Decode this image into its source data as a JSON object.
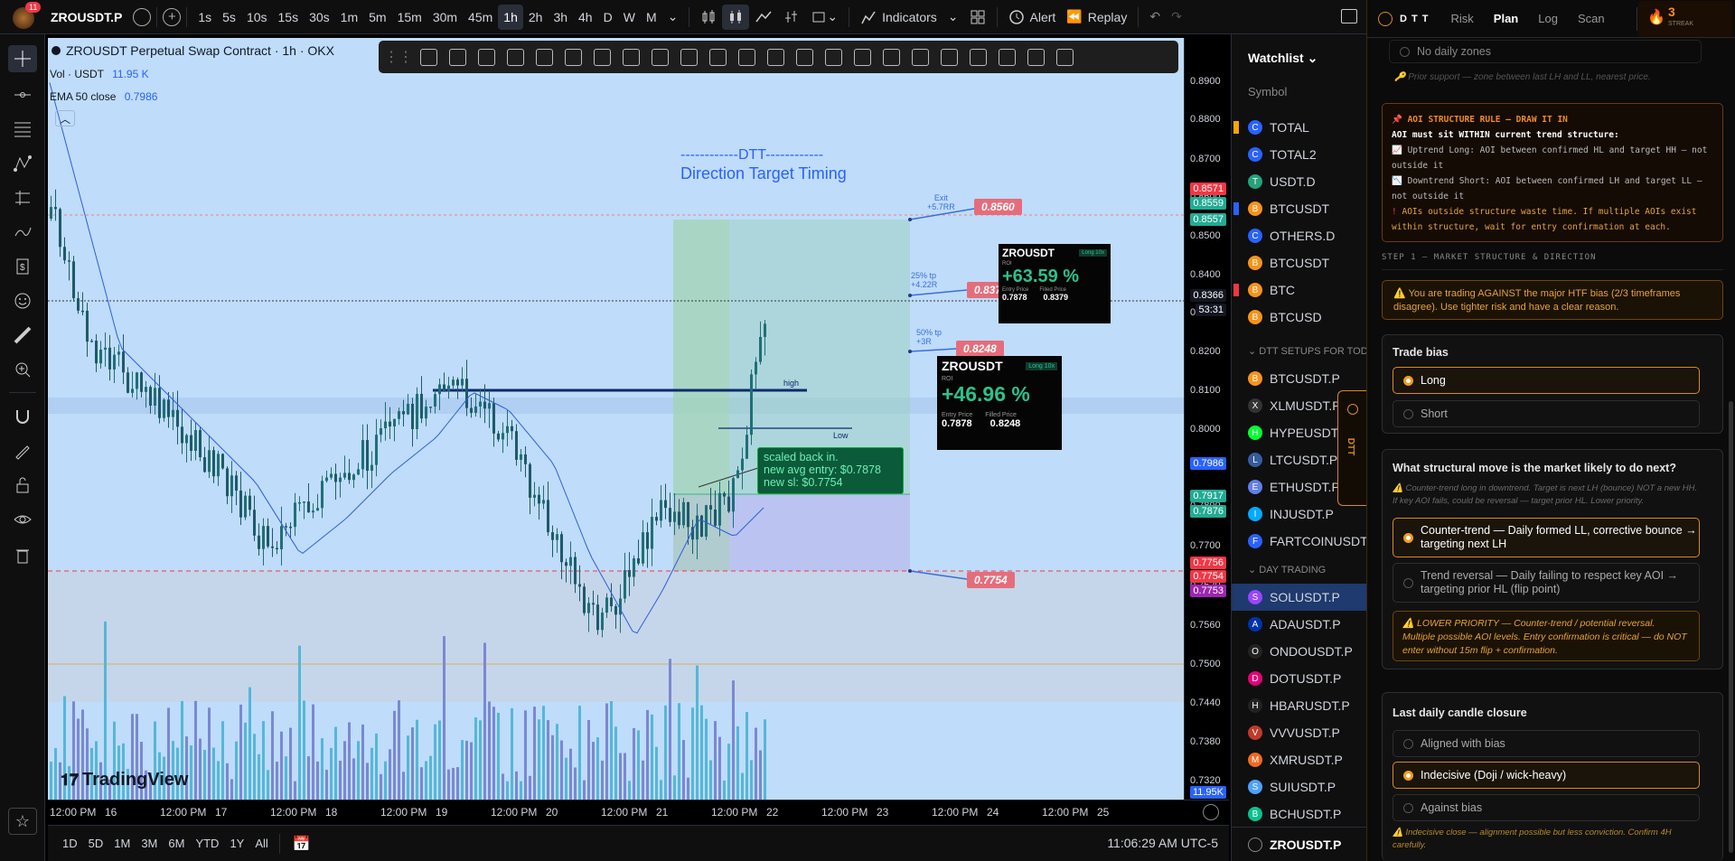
{
  "top": {
    "notif_count": "11",
    "symbol": "ZROUSDT.P",
    "intervals": [
      "1s",
      "5s",
      "10s",
      "15s",
      "30s",
      "1m",
      "5m",
      "15m",
      "30m",
      "45m",
      "1h",
      "2h",
      "3h",
      "4h",
      "D",
      "W",
      "M"
    ],
    "active_interval": "1h",
    "indicators": "Indicators",
    "alert": "Alert",
    "replay": "Replay"
  },
  "chart": {
    "title": "ZROUSDT Perpetual Swap Contract · 1h · OKX",
    "vol_label": "Vol · USDT",
    "vol_value": "11.95 K",
    "ema_label": "EMA 50 close",
    "ema_value": "0.7986",
    "dtt_dashes": "------------DTT------------",
    "dtt_sub": "Direction Target Timing",
    "exit_label": "Exit\n+5.7RR",
    "tp25_label": "25% tp\n+4.22R",
    "tp50_label": "50% tp\n+3R",
    "tag_exit": "0.8560",
    "tag_tp25": "0.8379",
    "tag_tp50": "0.8248",
    "tag_sl": "0.7754",
    "high_label": "high",
    "low_label": "Low",
    "note_line1": "scaled back in.",
    "note_line2": "new avg entry: $0.7878",
    "note_line3": "new sl: $0.7754",
    "card1": {
      "sym": "ZROUSDT",
      "badge": "Long 10x",
      "roi_label": "ROI",
      "roi": "+63.59 %",
      "entry_label": "Entry Price",
      "filled_label": "Filled Price",
      "entry": "0.7878",
      "filled": "0.8379"
    },
    "card2": {
      "sym": "ZROUSDT",
      "badge": "Long 10x",
      "roi_label": "ROI",
      "roi": "+46.96 %",
      "entry_label": "Entry Price",
      "filled_label": "Filled Price",
      "entry": "0.7878",
      "filled": "0.8248"
    },
    "watermark": "TradingView"
  },
  "price_axis": {
    "ticks": [
      "0.8900",
      "0.8800",
      "0.8700",
      "0.8600",
      "0.8500",
      "0.8400",
      "0.8300",
      "0.8200",
      "0.8100",
      "0.8000",
      "0.7900",
      "0.7800",
      "0.7700",
      "0.7620",
      "0.7560",
      "0.7500",
      "0.7440",
      "0.7380",
      "0.7320"
    ],
    "labels": [
      {
        "text": "0.8571",
        "color": "#f23645"
      },
      {
        "text": "0.8559",
        "color": "#22ab94"
      },
      {
        "text": "0.8557",
        "color": "#22ab94"
      },
      {
        "text": "0.8366",
        "color": "#131722"
      },
      {
        "text": "53:31",
        "color": "#131722"
      },
      {
        "text": "0.7986",
        "color": "#2962ff"
      },
      {
        "text": "0.7917",
        "color": "#22ab94"
      },
      {
        "text": "0.7876",
        "color": "#22ab94"
      },
      {
        "text": "0.7756",
        "color": "#f23645"
      },
      {
        "text": "0.7754",
        "color": "#f23645"
      },
      {
        "text": "0.7753",
        "color": "#9c27b0"
      },
      {
        "text": "11.95K",
        "color": "#2962ff"
      }
    ]
  },
  "time_axis": [
    "12:00 PM",
    "16",
    "12:00 PM",
    "17",
    "12:00 PM",
    "18",
    "12:00 PM",
    "19",
    "12:00 PM",
    "20",
    "12:00 PM",
    "21",
    "12:00 PM",
    "22",
    "12:00 PM",
    "23",
    "12:00 PM",
    "24",
    "12:00 PM",
    "25"
  ],
  "bottom": {
    "ranges": [
      "1D",
      "5D",
      "1M",
      "3M",
      "6M",
      "YTD",
      "1Y",
      "All"
    ],
    "clock": "11:06:29 AM UTC-5"
  },
  "watchlist": {
    "title": "Watchlist",
    "col": "Symbol",
    "items": [
      {
        "sym": "TOTAL",
        "color": "#2962ff",
        "icon": "C",
        "flag": "#f7a600"
      },
      {
        "sym": "TOTAL2",
        "color": "#2962ff",
        "icon": "C",
        "flag": ""
      },
      {
        "sym": "USDT.D",
        "color": "#26a17b",
        "icon": "T",
        "flag": ""
      },
      {
        "sym": "BTCUSDT",
        "color": "#f7931a",
        "icon": "B",
        "flag": "#2962ff"
      },
      {
        "sym": "OTHERS.D",
        "color": "#2962ff",
        "icon": "C",
        "flag": ""
      },
      {
        "sym": "BTCUSDT",
        "color": "#f7931a",
        "icon": "B",
        "flag": ""
      },
      {
        "sym": "BTC",
        "color": "#f7931a",
        "icon": "B",
        "flag": "#f23645"
      },
      {
        "sym": "BTCUSD",
        "color": "#f7931a",
        "icon": "B",
        "flag": ""
      }
    ],
    "section1": "DTT SETUPS FOR TOD",
    "items2": [
      {
        "sym": "BTCUSDT.P",
        "color": "#f7931a",
        "icon": "B"
      },
      {
        "sym": "XLMUSDT.P",
        "color": "#333",
        "icon": "X"
      },
      {
        "sym": "HYPEUSDT.P",
        "color": "#0f3",
        "icon": "H"
      },
      {
        "sym": "LTCUSDT.P",
        "color": "#345d9d",
        "icon": "L"
      },
      {
        "sym": "ETHUSDT.P",
        "color": "#627eea",
        "icon": "E"
      },
      {
        "sym": "INJUSDT.P",
        "color": "#00aaff",
        "icon": "I"
      },
      {
        "sym": "FARTCOINUSDT.P",
        "color": "#2962ff",
        "icon": "F"
      }
    ],
    "section2": "DAY TRADING",
    "items3": [
      {
        "sym": "SOLUSDT.P",
        "color": "#9945ff",
        "icon": "S",
        "active": true
      },
      {
        "sym": "ADAUSDT.P",
        "color": "#0033ad",
        "icon": "A"
      },
      {
        "sym": "ONDOUSDT.P",
        "color": "#222",
        "icon": "O"
      },
      {
        "sym": "DOTUSDT.P",
        "color": "#e6007a",
        "icon": "D"
      },
      {
        "sym": "HBARUSDT.P",
        "color": "#222",
        "icon": "H"
      },
      {
        "sym": "VVVUSDT.P",
        "color": "#c0392b",
        "icon": "V"
      },
      {
        "sym": "XMRUSDT.P",
        "color": "#f26822",
        "icon": "M"
      },
      {
        "sym": "SUIUSDT.P",
        "color": "#4da2ff",
        "icon": "S"
      },
      {
        "sym": "BCHUSDT.P",
        "color": "#0ac18e",
        "icon": "B"
      }
    ],
    "footer": "ZROUSDT.P",
    "dtt_tab": "DTT"
  },
  "panel": {
    "brand": "D T T",
    "tabs": [
      "Risk",
      "Plan",
      "Log",
      "Scan"
    ],
    "active_tab": "Plan",
    "streak_num": "3",
    "streak_label": "STREAK",
    "no_daily": "No daily zones",
    "prior_support": "Prior support — zone between last LH and LL, nearest price.",
    "aoi_title": "AOI STRUCTURE RULE — DRAW IT IN",
    "aoi_l1": "AOI must sit WITHIN current trend structure:",
    "aoi_l2": "Uptrend Long: AOI between confirmed HL and target HH — not outside it",
    "aoi_l3": "Downtrend Short: AOI between confirmed LH and target LL — not outside it",
    "aoi_l4": "AOIs outside structure waste time. If multiple AOIs exist within structure, wait for entry confirmation at each.",
    "step1": "STEP 1 — MARKET STRUCTURE & DIRECTION",
    "htf_warn": "You are trading AGAINST the major HTF bias (2/3 timeframes disagree). Use tighter risk and have a clear reason.",
    "bias_title": "Trade bias",
    "bias_opts": [
      "Long",
      "Short"
    ],
    "move_title": "What structural move is the market likely to do next?",
    "move_hint": "Counter-trend long in downtrend. Target is next LH (bounce) NOT a new HH. If key AOI fails, could be reversal — target prior HL. Lower priority.",
    "move_opt1": "Counter-trend — Daily formed LL, corrective bounce → targeting next LH",
    "move_opt2": "Trend reversal — Daily failing to respect key AOI → targeting prior HL (flip point)",
    "lower_warn": "LOWER PRIORITY — Counter-trend / potential reversal. Multiple possible AOI levels. Entry confirmation is critical — do NOT enter without 15m flip + confirmation.",
    "close_title": "Last daily candle closure",
    "close_opts": [
      "Aligned with bias",
      "Indecisive (Doji / wick-heavy)",
      "Against bias"
    ],
    "close_hint": "Indecisive close — alignment possible but less conviction. Confirm 4H carefully."
  }
}
